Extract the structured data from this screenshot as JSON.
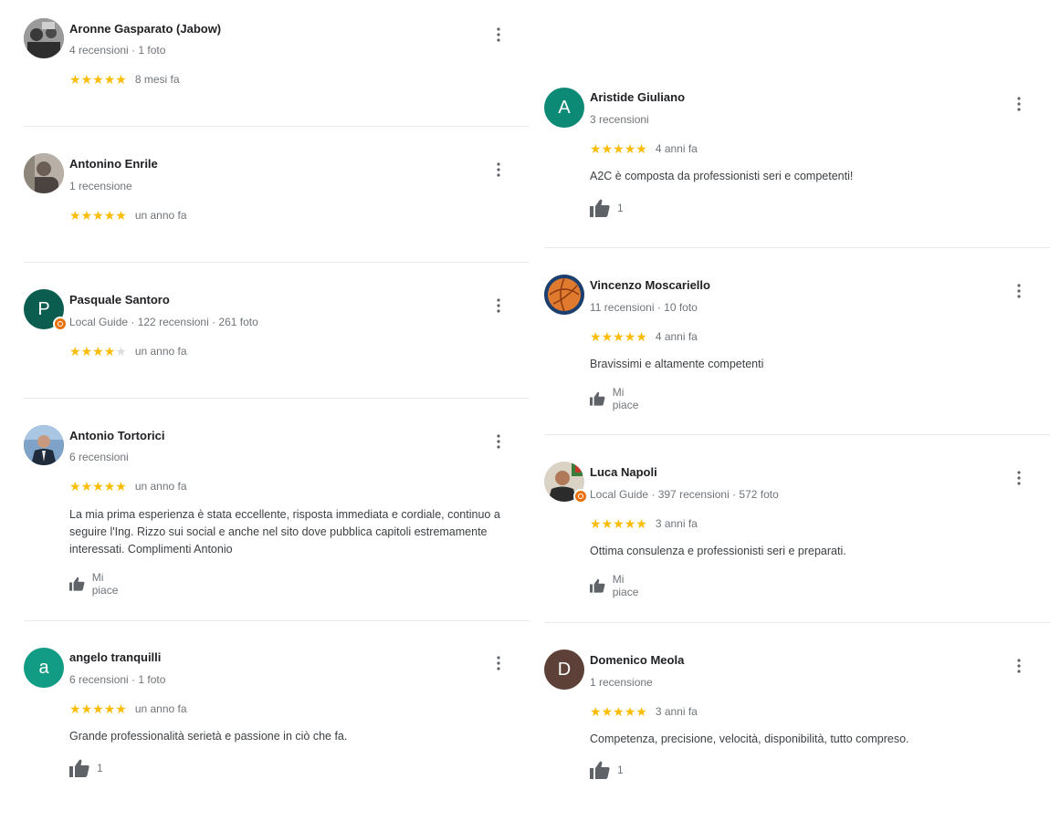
{
  "reviews_left": [
    {
      "name": "Aronne Gasparato (Jabow)",
      "meta": "4 recensioni · 1 foto",
      "rating": 5,
      "time": "8 mesi fa",
      "avatar_type": "photo"
    },
    {
      "name": "Antonino Enrile",
      "meta": "1 recensione",
      "rating": 5,
      "time": "un anno fa",
      "avatar_type": "photo"
    },
    {
      "name": "Pasquale Santoro",
      "guide": "Local Guide",
      "meta": " · 122 recensioni · 261 foto",
      "rating": 4,
      "time": "un anno fa",
      "avatar_letter": "P",
      "avatar_color": "#0b5e4f"
    },
    {
      "name": "Antonio Tortorici",
      "meta": "6 recensioni",
      "rating": 5,
      "time": "un anno fa",
      "avatar_type": "photo",
      "text": "La mia prima esperienza è stata eccellente, risposta immediata e cordiale, continuo a seguire l'Ing. Rizzo sui social e anche nel sito dove pubblica capitoli estremamente interessati. Complimenti Antonio",
      "like_label": "Mi piace"
    },
    {
      "name": "angelo tranquilli",
      "meta": "6 recensioni · 1 foto",
      "rating": 5,
      "time": "un anno fa",
      "avatar_letter": "a",
      "avatar_color": "#129c85",
      "text": "Grande professionalità serietà e passione in ciò che fa.",
      "like_label": "1"
    }
  ],
  "reviews_right": [
    {
      "name": "Aristide Giuliano",
      "meta": "3 recensioni",
      "rating": 5,
      "time": "4 anni fa",
      "avatar_letter": "A",
      "avatar_color": "#0d8a76",
      "text": "A2C è composta da professionisti seri e competenti!",
      "like_label": "1"
    },
    {
      "name": "Vincenzo Moscariello",
      "meta": "11 recensioni · 10 foto",
      "rating": 5,
      "time": "4 anni fa",
      "avatar_type": "photo",
      "text": "Bravissimi e altamente competenti",
      "like_label": "Mi piace"
    },
    {
      "name": "Luca Napoli",
      "guide": "Local Guide",
      "meta": " · 397 recensioni · 572 foto",
      "rating": 5,
      "time": "3 anni fa",
      "avatar_type": "photo",
      "text": "Ottima consulenza e professionisti seri e preparati.",
      "like_label": "Mi piace"
    },
    {
      "name": "Domenico Meola",
      "meta": "1 recensione",
      "rating": 5,
      "time": "3 anni fa",
      "avatar_letter": "D",
      "avatar_color": "#5d4037",
      "text": "Competenza, precisione, velocità, disponibilità, tutto compreso.",
      "like_label": "1"
    }
  ]
}
